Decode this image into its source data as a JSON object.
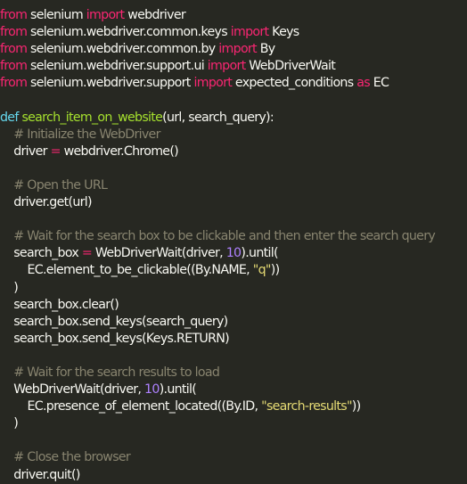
{
  "code": {
    "lines": [
      [
        {
          "t": "from",
          "c": "kw"
        },
        {
          "t": " selenium ",
          "c": "pl"
        },
        {
          "t": "import",
          "c": "kw"
        },
        {
          "t": " webdriver",
          "c": "pl"
        }
      ],
      [
        {
          "t": "from",
          "c": "kw"
        },
        {
          "t": " selenium.webdriver.common.keys ",
          "c": "pl"
        },
        {
          "t": "import",
          "c": "kw"
        },
        {
          "t": " Keys",
          "c": "pl"
        }
      ],
      [
        {
          "t": "from",
          "c": "kw"
        },
        {
          "t": " selenium.webdriver.common.by ",
          "c": "pl"
        },
        {
          "t": "import",
          "c": "kw"
        },
        {
          "t": " By",
          "c": "pl"
        }
      ],
      [
        {
          "t": "from",
          "c": "kw"
        },
        {
          "t": " selenium.webdriver.support.ui ",
          "c": "pl"
        },
        {
          "t": "import",
          "c": "kw"
        },
        {
          "t": " WebDriverWait",
          "c": "pl"
        }
      ],
      [
        {
          "t": "from",
          "c": "kw"
        },
        {
          "t": " selenium.webdriver.support ",
          "c": "pl"
        },
        {
          "t": "import",
          "c": "kw"
        },
        {
          "t": " expected_conditions ",
          "c": "pl"
        },
        {
          "t": "as",
          "c": "kw"
        },
        {
          "t": " EC",
          "c": "pl"
        }
      ],
      [],
      [
        {
          "t": "def",
          "c": "def"
        },
        {
          "t": " ",
          "c": "pl"
        },
        {
          "t": "search_item_on_website",
          "c": "fn"
        },
        {
          "t": "(url, search_query):",
          "c": "pl"
        }
      ],
      [
        {
          "t": "    ",
          "c": "pl"
        },
        {
          "t": "# Initialize the WebDriver",
          "c": "cm"
        }
      ],
      [
        {
          "t": "    driver ",
          "c": "pl"
        },
        {
          "t": "=",
          "c": "op"
        },
        {
          "t": " webdriver.Chrome()",
          "c": "pl"
        }
      ],
      [],
      [
        {
          "t": "    ",
          "c": "pl"
        },
        {
          "t": "# Open the URL",
          "c": "cm"
        }
      ],
      [
        {
          "t": "    driver.get(url)",
          "c": "pl"
        }
      ],
      [],
      [
        {
          "t": "    ",
          "c": "pl"
        },
        {
          "t": "# Wait for the search box to be clickable and then enter the search query",
          "c": "cm"
        }
      ],
      [
        {
          "t": "    search_box ",
          "c": "pl"
        },
        {
          "t": "=",
          "c": "op"
        },
        {
          "t": " WebDriverWait(driver, ",
          "c": "pl"
        },
        {
          "t": "10",
          "c": "num"
        },
        {
          "t": ").until(",
          "c": "pl"
        }
      ],
      [
        {
          "t": "        EC.element_to_be_clickable((By.NAME, ",
          "c": "pl"
        },
        {
          "t": "\"q\"",
          "c": "str"
        },
        {
          "t": "))",
          "c": "pl"
        }
      ],
      [
        {
          "t": "    )",
          "c": "pl"
        }
      ],
      [
        {
          "t": "    search_box.clear()",
          "c": "pl"
        }
      ],
      [
        {
          "t": "    search_box.send_keys(search_query)",
          "c": "pl"
        }
      ],
      [
        {
          "t": "    search_box.send_keys(Keys.RETURN)",
          "c": "pl"
        }
      ],
      [],
      [
        {
          "t": "    ",
          "c": "pl"
        },
        {
          "t": "# Wait for the search results to load",
          "c": "cm"
        }
      ],
      [
        {
          "t": "    WebDriverWait(driver, ",
          "c": "pl"
        },
        {
          "t": "10",
          "c": "num"
        },
        {
          "t": ").until(",
          "c": "pl"
        }
      ],
      [
        {
          "t": "        EC.presence_of_element_located((By.ID, ",
          "c": "pl"
        },
        {
          "t": "\"search-results\"",
          "c": "str"
        },
        {
          "t": "))",
          "c": "pl"
        }
      ],
      [
        {
          "t": "    )",
          "c": "pl"
        }
      ],
      [],
      [
        {
          "t": "    ",
          "c": "pl"
        },
        {
          "t": "# Close the browser",
          "c": "cm"
        }
      ],
      [
        {
          "t": "    driver.quit()",
          "c": "pl"
        }
      ]
    ]
  },
  "colors": {
    "background": "#272822",
    "keyword": "#f92672",
    "builtin": "#66d9ef",
    "function": "#a6e22e",
    "comment": "#88846f",
    "string": "#e6db74",
    "number": "#ae81ff",
    "text": "#f8f8f2"
  }
}
